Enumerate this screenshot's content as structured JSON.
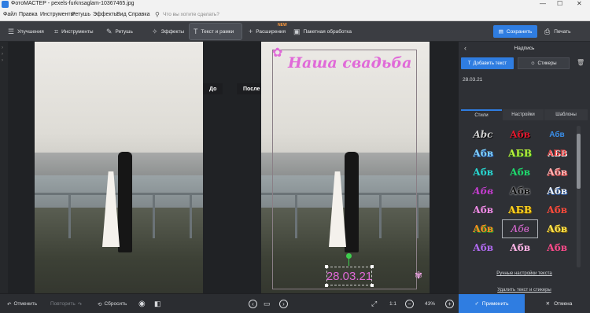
{
  "window": {
    "title": "ФотоМАСТЕР - pexels-furknsaglam-10367465.jpg",
    "minimize": "—",
    "maximize": "☐",
    "close": "✕"
  },
  "menu": {
    "items": [
      "Файл",
      "Правка",
      "Инструменты",
      "Ретушь",
      "Эффекты",
      "Вид",
      "Справка"
    ],
    "search_placeholder": "Что вы хотите сделать?"
  },
  "toolbar": {
    "tabs": [
      {
        "label": "Улучшения",
        "icon": "sliders-icon"
      },
      {
        "label": "Инструменты",
        "icon": "crop-icon"
      },
      {
        "label": "Ретушь",
        "icon": "brush-icon"
      },
      {
        "label": "Эффекты",
        "icon": "wand-icon"
      },
      {
        "label": "Текст и рамки",
        "icon": "text-icon",
        "active": true
      },
      {
        "label": "Расширения",
        "icon": "plus-icon",
        "badge": "NEW"
      },
      {
        "label": "Пакетная обработка",
        "icon": "images-icon"
      }
    ],
    "save": "Сохранить",
    "print": "Печать"
  },
  "preview": {
    "before_label": "До",
    "after_label": "После",
    "overlay_title": "Наша свадьба",
    "overlay_date": "28.03.21"
  },
  "panel": {
    "title": "Надпись",
    "add_text": "Добавить текст",
    "stickers": "Стикеры",
    "text_value": "28.03.21",
    "tabs": [
      "Стили",
      "Настройки",
      "Шаблоны"
    ],
    "style_samples": [
      "Abc",
      "Абв",
      "Абв",
      "Абв",
      "АБВ",
      "АБВ",
      "Абв",
      "Абв",
      "Абв",
      "Абв",
      "Абв",
      "Абв",
      "Абв",
      "АБВ",
      "Абв",
      "Абв",
      "Абв",
      "Абв",
      "Абв",
      "Абв",
      "Абв"
    ],
    "manual_link": "Ручные настройки текста",
    "delete_link": "Удалить текст и стикеры",
    "apply": "Применить",
    "cancel": "Отмена"
  },
  "bottom": {
    "undo": "Отменить",
    "redo": "Повторить",
    "reset": "Сбросить",
    "ratio": "1:1",
    "zoom": "43%"
  },
  "colors": {
    "accent": "#2f7de1",
    "title_pink": "#e06ad8",
    "badge": "#ff9a3c"
  }
}
